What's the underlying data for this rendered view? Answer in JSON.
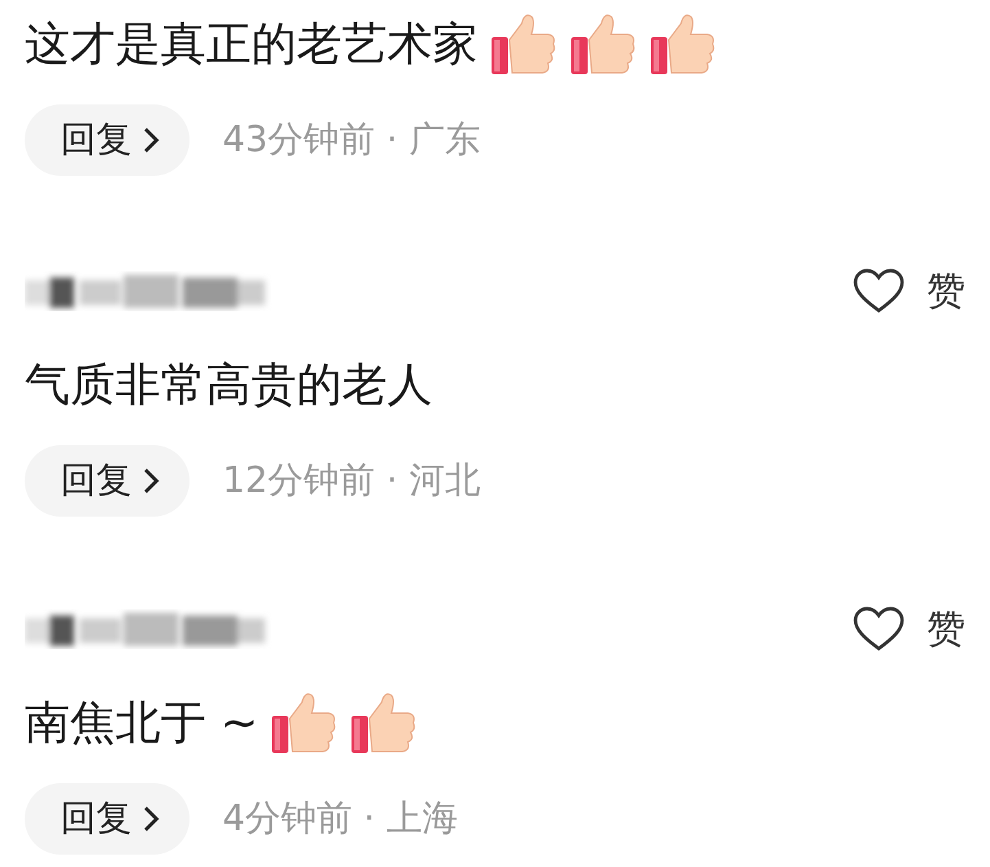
{
  "comments": [
    {
      "has_author": false,
      "text": "这才是真正的老艺术家",
      "emoji": [
        {
          "kind": "thumbs-up"
        },
        {
          "kind": "thumbs-up"
        },
        {
          "kind": "thumbs-up"
        }
      ],
      "reply": "回复",
      "meta": "43分钟前 · 广东"
    },
    {
      "has_author": true,
      "like": "赞",
      "text": "气质非常高贵的老人",
      "reply": "回复",
      "meta": "12分钟前 · 河北"
    },
    {
      "has_author": true,
      "like": "赞",
      "text": "南焦北于 ~",
      "emoji": [
        {
          "kind": "thumbs-up"
        },
        {
          "kind": "thumbs-up"
        }
      ],
      "reply": "回复",
      "meta": "4分钟前 · 上海"
    }
  ]
}
